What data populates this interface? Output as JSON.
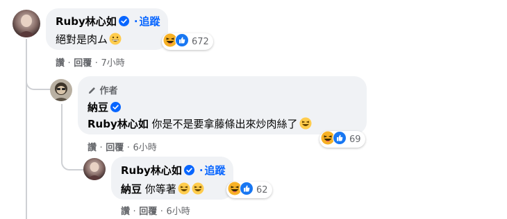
{
  "comments": [
    {
      "author": "Ruby林心如",
      "verified": true,
      "follow_label": "追蹤",
      "text": "絕對是肉ム",
      "text_emoji": "grinning-face-icon",
      "reactions": {
        "icons": [
          "laugh-reaction-icon",
          "like-reaction-icon"
        ],
        "count": "672"
      },
      "actions": {
        "read": "讚",
        "reply": "回覆",
        "time": "7小時"
      }
    },
    {
      "author_tag": "作者",
      "author": "納豆",
      "verified": true,
      "mention": "Ruby林心如",
      "text": "你是不是要拿藤條出來炒肉絲了",
      "text_emoji": "laughing-face-icon",
      "reactions": {
        "icons": [
          "laugh-reaction-icon",
          "like-reaction-icon"
        ],
        "count": "69"
      },
      "actions": {
        "read": "讚",
        "reply": "回覆",
        "time": "6小時"
      }
    },
    {
      "author": "Ruby林心如",
      "verified": true,
      "follow_label": "追蹤",
      "mention": "納豆",
      "text": "你等著",
      "text_emoji": "laughing-face-icon",
      "reactions": {
        "icons": [
          "laugh-reaction-icon",
          "like-reaction-icon"
        ],
        "count": "62"
      },
      "actions": {
        "read": "讚",
        "reply": "回覆",
        "time": "6小時"
      }
    }
  ],
  "separator": "·",
  "colors": {
    "link": "#0866ff",
    "bubble": "#f0f2f5",
    "muted": "#65676b",
    "line": "#ced0d4"
  }
}
